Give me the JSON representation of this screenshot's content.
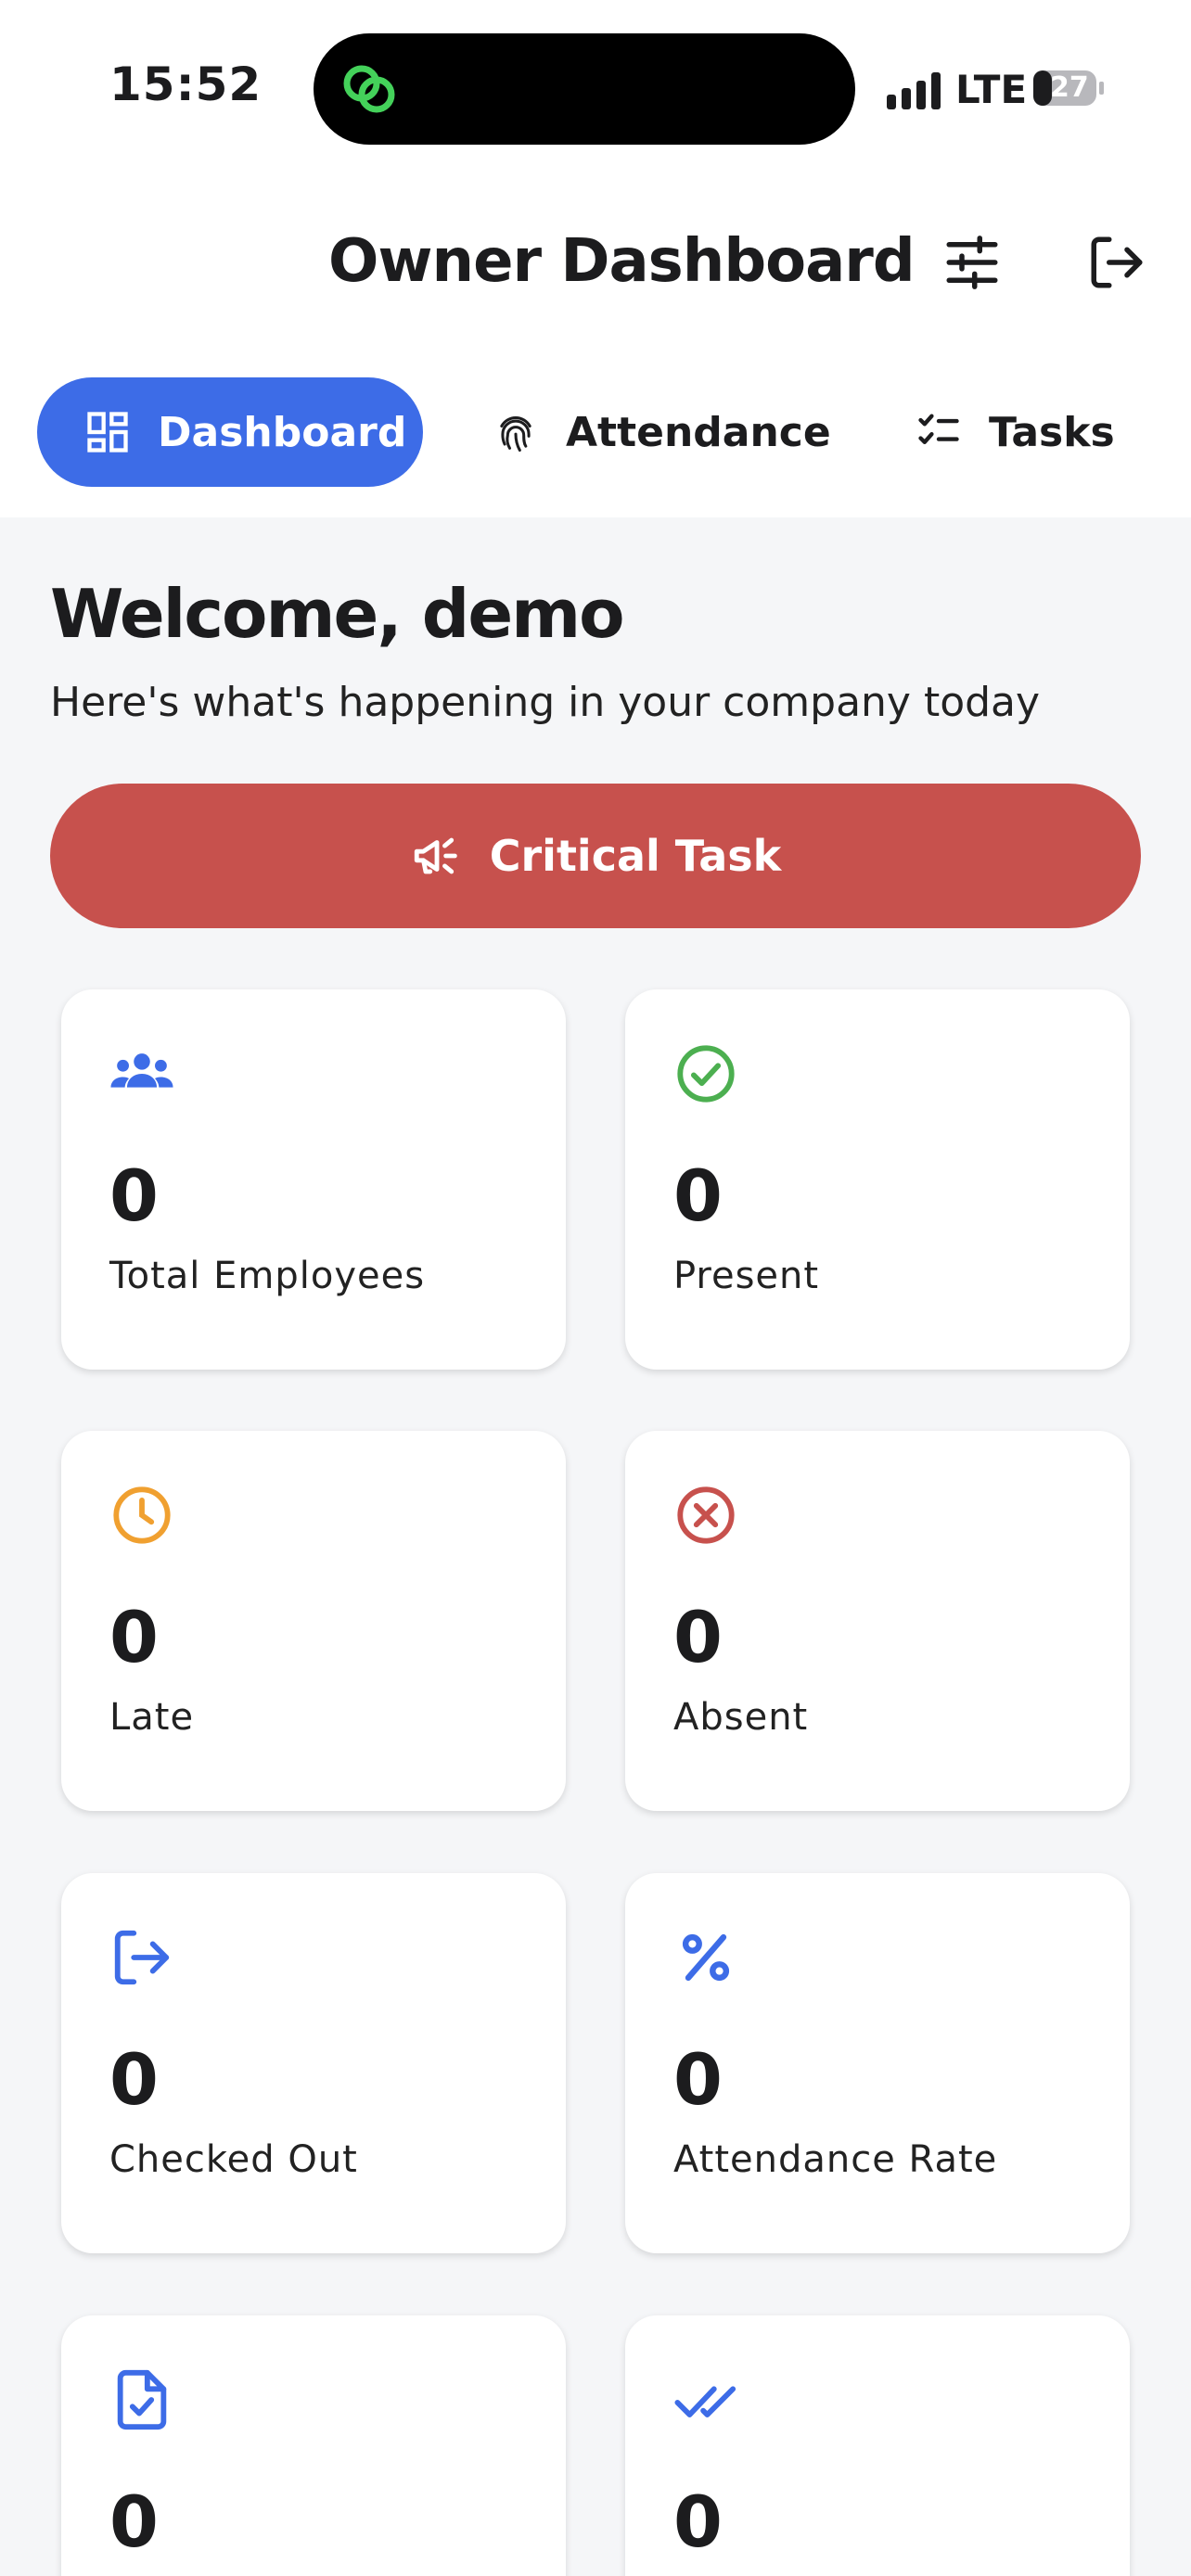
{
  "status_bar": {
    "time": "15:52",
    "network": "LTE",
    "battery": "27"
  },
  "header": {
    "title": "Owner Dashboard",
    "filter_icon": "sliders-icon",
    "logout_icon": "logout-icon"
  },
  "tabs": [
    {
      "label": "Dashboard",
      "icon": "dashboard-grid-icon",
      "active": true
    },
    {
      "label": "Attendance",
      "icon": "fingerprint-icon",
      "active": false
    },
    {
      "label": "Tasks",
      "icon": "checklist-icon",
      "active": false
    }
  ],
  "welcome": {
    "title": "Welcome, demo",
    "subtitle": "Here's what's happening in your company today"
  },
  "critical_task": {
    "label": "Critical Task",
    "icon": "megaphone-icon",
    "color": "#c7514d"
  },
  "colors": {
    "accent": "#3d6ce7",
    "success": "#4caf50",
    "warning": "#f0a030",
    "danger": "#c7514d"
  },
  "stats": [
    {
      "value": "0",
      "label": "Total Employees",
      "icon": "group-icon"
    },
    {
      "value": "0",
      "label": "Present",
      "icon": "check-circle-icon"
    },
    {
      "value": "0",
      "label": "Late",
      "icon": "clock-icon"
    },
    {
      "value": "0",
      "label": "Absent",
      "icon": "cancel-circle-icon"
    },
    {
      "value": "0",
      "label": "Checked Out",
      "icon": "logout-icon"
    },
    {
      "value": "0",
      "label": "Attendance Rate",
      "icon": "percent-icon"
    },
    {
      "value": "0",
      "label": "",
      "icon": "task-document-icon"
    },
    {
      "value": "0",
      "label": "",
      "icon": "double-check-icon"
    }
  ]
}
